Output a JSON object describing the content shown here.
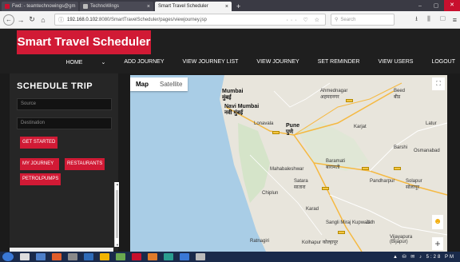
{
  "browser": {
    "tabs": [
      {
        "label": "Fwd: - teamtechnowings@gm",
        "active": false
      },
      {
        "label": "TechnoWings",
        "active": false
      },
      {
        "label": "Smart Travel Scheduler",
        "active": true
      }
    ],
    "new_tab": "+",
    "url_host": "192.168.0.102",
    "url_path": ":8080/SmartTravelScheduler/pages/viewjourney.jsp",
    "search_placeholder": "Search",
    "actions": "··· ♡ ☆",
    "tool_icons": "⭳ ⫼ ▢"
  },
  "app": {
    "brand": "Smart Travel Scheduler",
    "menu": [
      "HOME",
      "ADD JOURNEY",
      "VIEW JOURNEY LIST",
      "VIEW JOURNEY",
      "SET REMINDER",
      "VIEW USERS",
      "LOGOUT"
    ]
  },
  "sidebar": {
    "title": "SCHEDULE TRIP",
    "source_placeholder": "Source",
    "destination_placeholder": "Destination",
    "get_started": "GET STARTED",
    "my_journey": "MY JOURNEY",
    "restaurants": "RESTAURANTS",
    "petrolpumps": "PETROLPUMPS"
  },
  "map": {
    "types": [
      "Map",
      "Satellite"
    ],
    "cities": [
      {
        "name": "Mumbai",
        "sub": "मुंबई",
        "big": true
      },
      {
        "name": "Navi Mumbai",
        "sub": "नवी मुंबई",
        "big": true
      },
      {
        "name": "Pune",
        "sub": "पुणे",
        "big": true
      },
      {
        "name": "Ahmednagar",
        "sub": "अहमदनगर",
        "big": false
      },
      {
        "name": "Beed",
        "sub": "बीड",
        "big": false
      },
      {
        "name": "Lonavala",
        "sub": "",
        "big": false
      },
      {
        "name": "Karjat",
        "sub": "",
        "big": false
      },
      {
        "name": "Baramati",
        "sub": "बारामती",
        "big": false
      },
      {
        "name": "Satara",
        "sub": "सातारा",
        "big": false
      },
      {
        "name": "Pandharpur",
        "sub": "",
        "big": false
      },
      {
        "name": "Solapur",
        "sub": "सोलापूर",
        "big": false
      },
      {
        "name": "Barshi",
        "sub": "",
        "big": false
      },
      {
        "name": "Osmanabad",
        "sub": "",
        "big": false
      },
      {
        "name": "Chiplun",
        "sub": "",
        "big": false
      },
      {
        "name": "Karad",
        "sub": "",
        "big": false
      },
      {
        "name": "Sangli Miraj Kupwad",
        "sub": "",
        "big": false
      },
      {
        "name": "Jath",
        "sub": "",
        "big": false
      },
      {
        "name": "Kolhapur",
        "sub": "कोल्हापूर",
        "big": false
      },
      {
        "name": "Vijayapura",
        "sub": "(Bijapur)",
        "big": false
      },
      {
        "name": "Latur",
        "sub": "",
        "big": false
      },
      {
        "name": "Ratnagiri",
        "sub": "",
        "big": false
      },
      {
        "name": "Mahabaleshwar",
        "sub": "",
        "big": false
      }
    ]
  },
  "taskbar": {
    "tray": "▲ ⛁ ✉ ♪ 5:28 PM"
  },
  "colors": {
    "brand": "#d11a35",
    "header_bg": "#1f1f1f",
    "sidebar_bg": "#262626",
    "land": "#e8e5dc",
    "sea": "#a9cde6"
  }
}
